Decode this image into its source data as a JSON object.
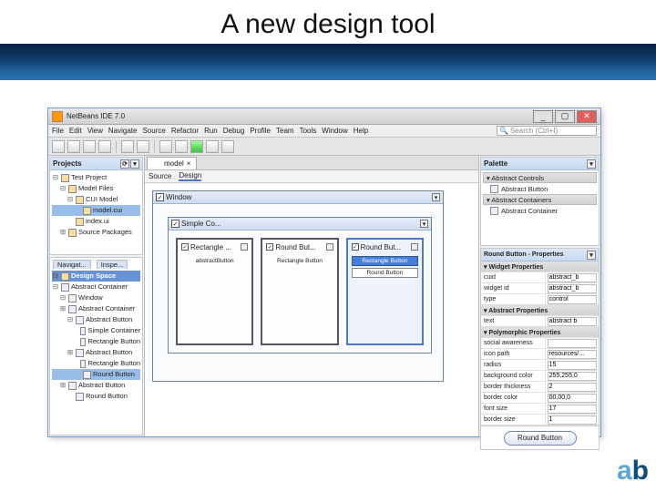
{
  "slide_title": "A new design tool",
  "window_title": "NetBeans IDE 7.0",
  "window_buttons": {
    "min": "_",
    "max": "▢",
    "close": "✕"
  },
  "search_placeholder": "Search (Ctrl+I)",
  "menus": [
    "File",
    "Edit",
    "View",
    "Navigate",
    "Source",
    "Refactor",
    "Run",
    "Debug",
    "Profile",
    "Team",
    "Tools",
    "Window",
    "Help"
  ],
  "tabs": {
    "editor": "model",
    "editor_close": "×",
    "subtabs": [
      "Source",
      "Design"
    ],
    "subtabs_active_index": 1
  },
  "projects": {
    "title": "Projects",
    "tree": [
      {
        "t": "⊟",
        "icon": true,
        "label": "Test Project",
        "ind": 0
      },
      {
        "t": "⊟",
        "icon": true,
        "label": "Model Files",
        "ind": 1
      },
      {
        "t": "⊟",
        "icon": true,
        "label": "CUI Model",
        "ind": 2
      },
      {
        "t": "",
        "icon": true,
        "label": "model.cui",
        "ind": 3,
        "sel": true
      },
      {
        "t": "",
        "icon": true,
        "label": "index.ui",
        "ind": 2
      },
      {
        "t": "⊞",
        "icon": true,
        "label": "Source Packages",
        "ind": 1
      }
    ]
  },
  "navigator": {
    "title": "Navigator",
    "tabs": [
      "Navigat...",
      "Inspe..."
    ],
    "root": "Design Space",
    "tree": [
      {
        "t": "⊟",
        "label": "Abstract Container",
        "ind": 0
      },
      {
        "t": "⊟",
        "label": "Window",
        "ind": 1
      },
      {
        "t": "⊞",
        "label": "Abstract Container",
        "ind": 1
      },
      {
        "t": "⊟",
        "label": "Abstract Button",
        "ind": 2
      },
      {
        "t": "",
        "label": "Simple Container",
        "ind": 3
      },
      {
        "t": "",
        "label": "Rectangle Button",
        "ind": 3
      },
      {
        "t": "⊞",
        "label": "Abstract Button",
        "ind": 2
      },
      {
        "t": "",
        "label": "Rectangle Button",
        "ind": 3
      },
      {
        "t": "",
        "label": "Round Button",
        "ind": 3,
        "sel": true
      },
      {
        "t": "⊞",
        "label": "Abstract Button",
        "ind": 1
      },
      {
        "t": "",
        "label": "Round Button",
        "ind": 2
      }
    ]
  },
  "palette": {
    "title": "Palette",
    "categories": [
      {
        "name": "Abstract Controls",
        "items": [
          {
            "label": "Abstract Button"
          }
        ]
      },
      {
        "name": "Abstract Containers",
        "items": [
          {
            "label": "Abstract Container"
          }
        ]
      }
    ]
  },
  "properties": {
    "title": "Round Button - Properties",
    "sections": [
      {
        "name": "Widget Properties",
        "rows": [
          {
            "k": "cuid",
            "v": "abstract_b"
          },
          {
            "k": "widget id",
            "v": "abstract_b"
          },
          {
            "k": "type",
            "v": "control"
          }
        ]
      },
      {
        "name": "Abstract Properties",
        "rows": [
          {
            "k": "text",
            "v": "abstract b"
          }
        ]
      },
      {
        "name": "Polymorphic Properties",
        "rows": [
          {
            "k": "social awareness",
            "v": ""
          },
          {
            "k": "icon path",
            "v": "resources/..."
          },
          {
            "k": "radius",
            "v": "15"
          },
          {
            "k": "background color",
            "v": "255,255,0"
          },
          {
            "k": "border thickness",
            "v": "2"
          },
          {
            "k": "border color",
            "v": "00,00,0"
          },
          {
            "k": "font size",
            "v": "17"
          },
          {
            "k": "border size",
            "v": "1"
          }
        ]
      }
    ],
    "preview_label": "Round Button"
  },
  "canvas": {
    "outer_window": "Window",
    "inner_window": "Simple Co...",
    "boxes": [
      {
        "title": "Rectangle ...",
        "children": [
          {
            "label": "abstractButton",
            "plain": true
          }
        ]
      },
      {
        "title": "Round But...",
        "children": [
          {
            "label": "Rectangle Button",
            "plain": true
          }
        ]
      },
      {
        "title": "Round But...",
        "sel": true,
        "children": [
          {
            "label": "Rectangle Button",
            "sel": true
          },
          {
            "label": "Round Button"
          }
        ]
      }
    ]
  },
  "logo": {
    "a": "a",
    "b": "b"
  }
}
